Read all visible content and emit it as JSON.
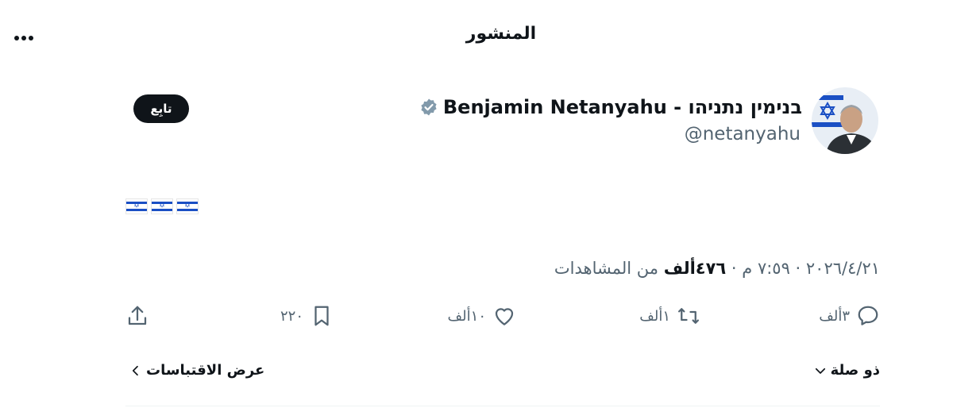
{
  "header": {
    "title": "المنشور"
  },
  "post": {
    "display_name": "Benjamin Netanyahu - בנימין נתניהו",
    "handle": "@netanyahu",
    "follow_label": "تابِع",
    "content_flags": [
      "il-flag",
      "il-flag",
      "il-flag"
    ],
    "timestamp": "٢٠٢٦/٤/٢١ · ٧:٥٩ م · ",
    "views_count": "٤٧٦ألف",
    "views_suffix": " من المشاهدات"
  },
  "actions": {
    "replies": "٣ألف",
    "reposts": "١ألف",
    "likes": "١٠ألف",
    "bookmarks": "٢٢٠"
  },
  "footer": {
    "sort_label": "ذو صلة",
    "quotes_label": "عرض الاقتباسات"
  },
  "colors": {
    "accent": "#0f1419",
    "muted": "#536471",
    "verified": "#829aab",
    "flag_blue": "#1a4fc4"
  }
}
